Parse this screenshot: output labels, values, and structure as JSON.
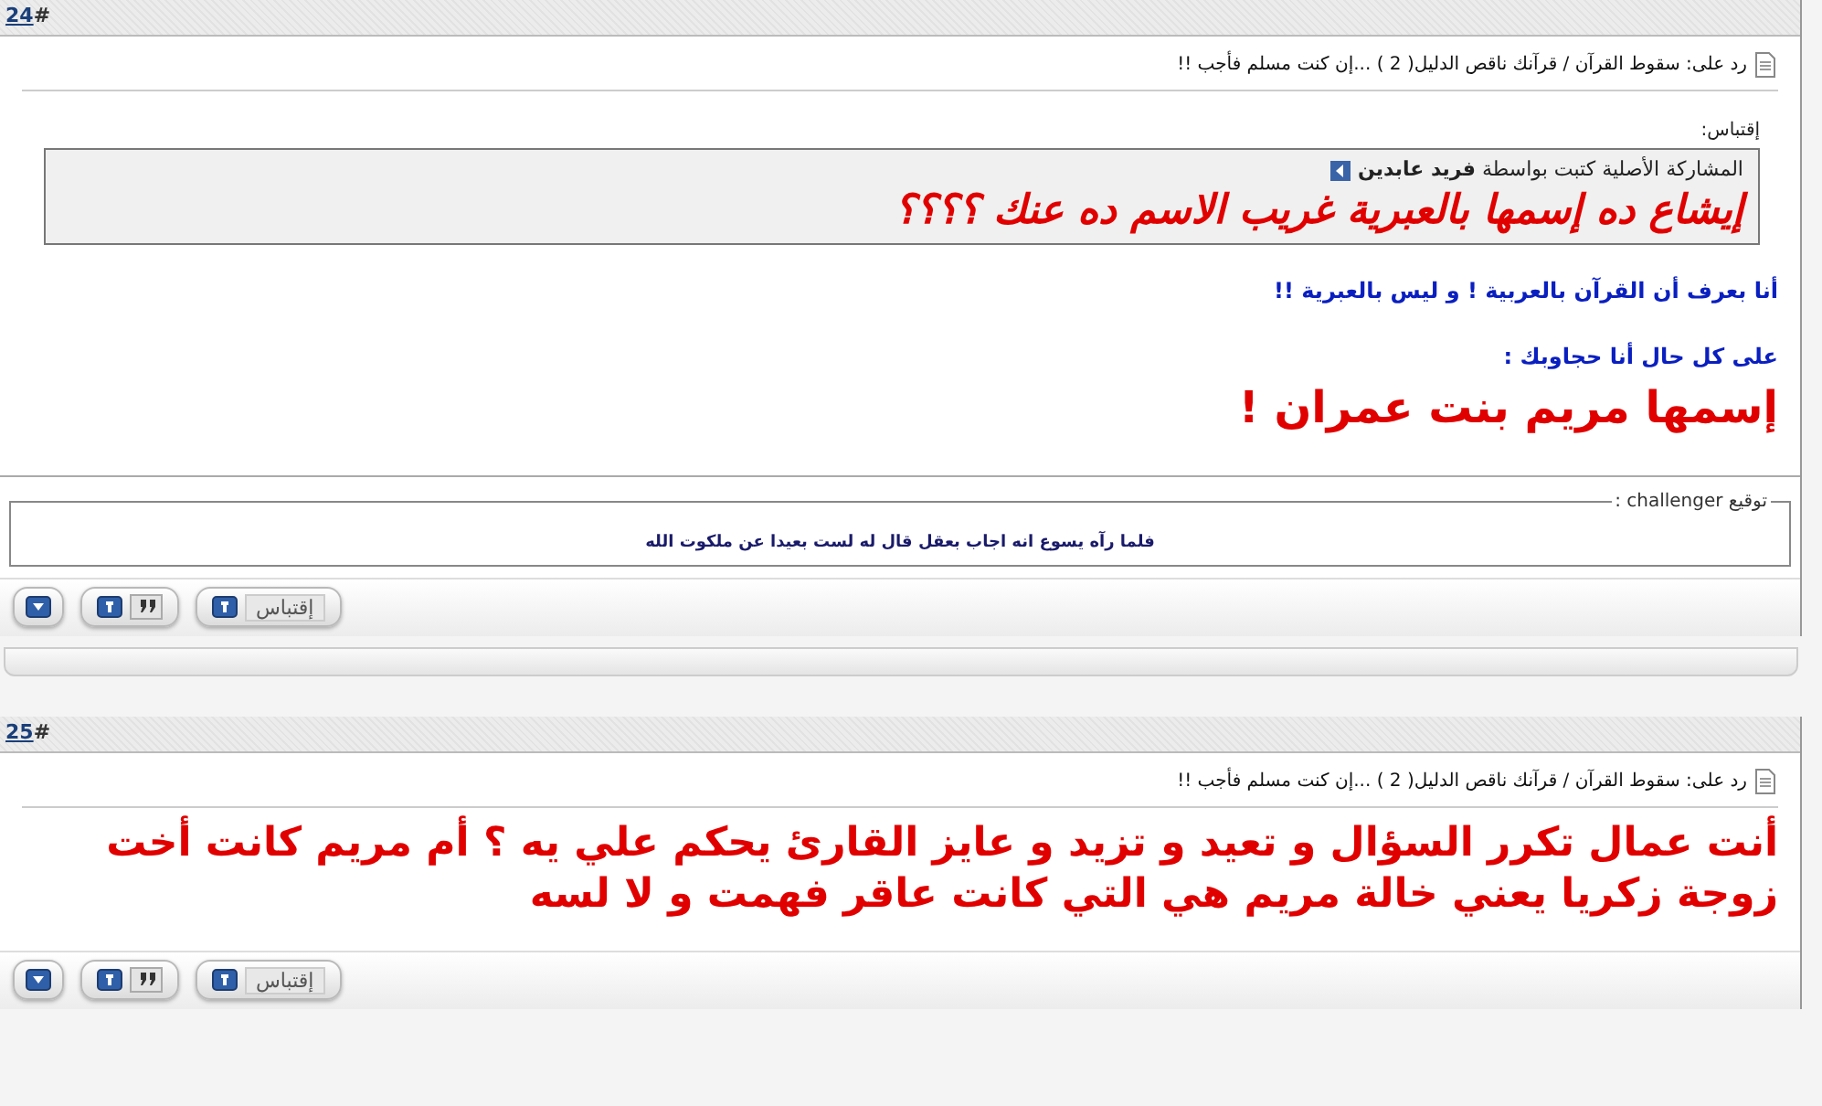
{
  "posts": [
    {
      "number": "24",
      "hash": "#",
      "title": "رد على: سقوط القرآن / قرآنك ناقص الدليل( 2 ) ...إن كنت مسلم فأجب !!",
      "quote": {
        "label": "إقتباس:",
        "attribution": "المشاركة الأصلية كتبت بواسطة **فريد عابدين**",
        "text": "إيشاع ده إسمها بالعبرية غريب الاسم ده عنك ؟؟؟؟"
      },
      "paragraphs": [
        {
          "kind": "blue",
          "text": "أنا بعرف أن القرآن بالعربية ! و ليس بالعبرية !!"
        },
        {
          "kind": "blue",
          "text": "على كل حال أنا حجاوبك :"
        },
        {
          "kind": "red",
          "text": "إسمها مريم بنت عمران !"
        }
      ],
      "signature": {
        "legend": "توقيع challenger :",
        "text": "فلما رآه يسوع انه اجاب **بعقل** قال له لست بعيدا عن ملكوت الله"
      },
      "quote_button": "إقتباس"
    },
    {
      "number": "25",
      "hash": "#",
      "title": "رد على: سقوط القرآن / قرآنك ناقص الدليل( 2 ) ...إن كنت مسلم فأجب !!",
      "paragraphs": [
        {
          "kind": "red",
          "text": "أنت عمال تكرر السؤال و تعيد و تزيد و عايز القارئ يحكم علي يه ؟ أم مريم كانت أخت زوجة زكريا يعني خالة مريم هي التي كانت عاقر فهمت و لا لسه"
        }
      ],
      "quote_button": "إقتباس"
    }
  ]
}
